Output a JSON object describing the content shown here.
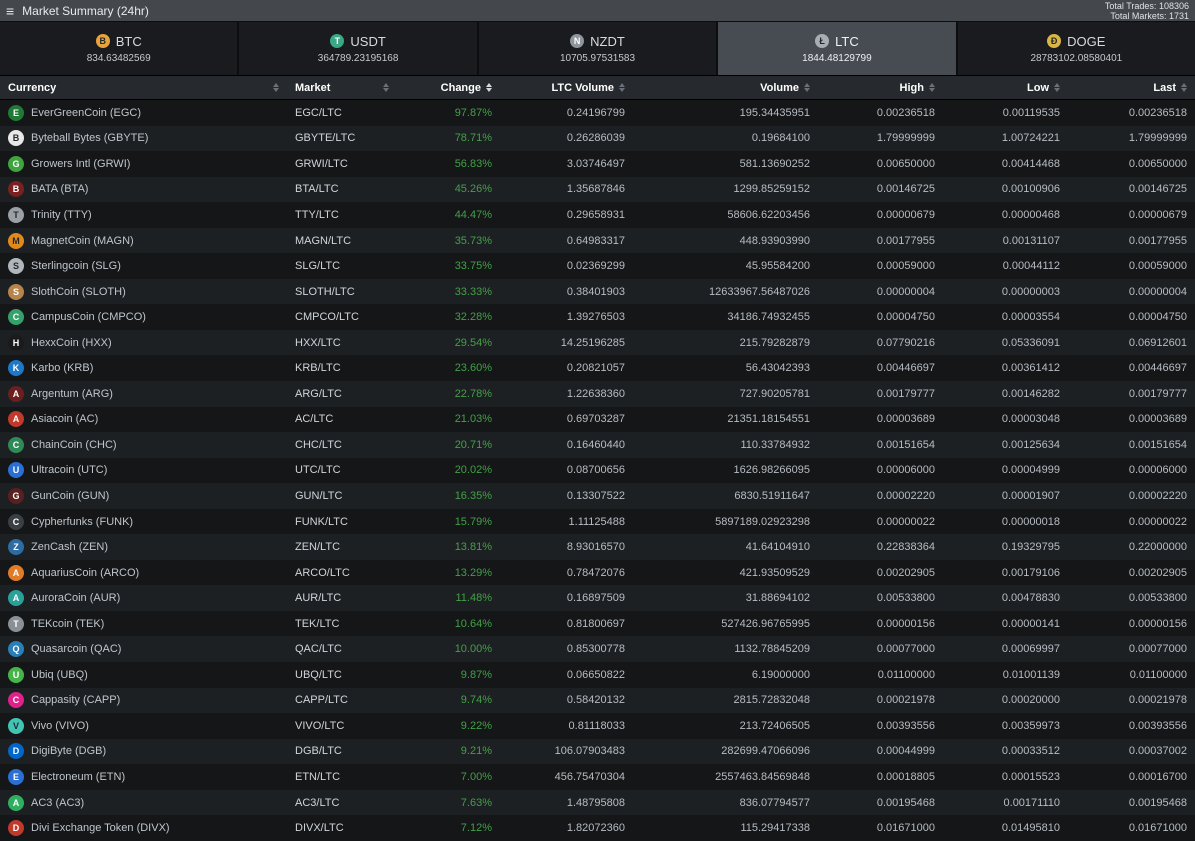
{
  "topbar": {
    "menu_icon": "≡",
    "title": "Market Summary (24hr)",
    "total_trades_label": "Total Trades:",
    "total_trades": "108306",
    "total_markets_label": "Total Markets:",
    "total_markets": "1731"
  },
  "tabs": [
    {
      "label": "BTC",
      "value": "834.63482569",
      "icon_letter": "B",
      "icon_color": "#e8a33d",
      "active": false
    },
    {
      "label": "USDT",
      "value": "364789.23195168",
      "icon_letter": "T",
      "icon_color": "#3aa884",
      "active": false
    },
    {
      "label": "NZDT",
      "value": "10705.97531583",
      "icon_letter": "N",
      "icon_color": "#8e959c",
      "active": false
    },
    {
      "label": "LTC",
      "value": "1844.48129799",
      "icon_letter": "Ł",
      "icon_color": "#a8adb3",
      "active": true
    },
    {
      "label": "DOGE",
      "value": "28783102.08580401",
      "icon_letter": "Ð",
      "icon_color": "#d8b545",
      "active": false
    }
  ],
  "table": {
    "columns": [
      {
        "label": "Currency",
        "align": "left"
      },
      {
        "label": "Market",
        "align": "left"
      },
      {
        "label": "Change",
        "align": "right"
      },
      {
        "label": "LTC Volume",
        "align": "right"
      },
      {
        "label": "Volume",
        "align": "right"
      },
      {
        "label": "High",
        "align": "right"
      },
      {
        "label": "Low",
        "align": "right"
      },
      {
        "label": "Last",
        "align": "right"
      }
    ],
    "sorted_column": "Change",
    "rows": [
      {
        "currency": "EverGreenCoin (EGC)",
        "icon_color": "#1e7a34",
        "market": "EGC/LTC",
        "change": "97.87%",
        "ltc_volume": "0.24196799",
        "volume": "195.34435951",
        "high": "0.00236518",
        "low": "0.00119535",
        "last": "0.00236518"
      },
      {
        "currency": "Byteball Bytes (GBYTE)",
        "icon_color": "#e8e8e8",
        "market": "GBYTE/LTC",
        "change": "78.71%",
        "ltc_volume": "0.26286039",
        "volume": "0.19684100",
        "high": "1.79999999",
        "low": "1.00724221",
        "last": "1.79999999"
      },
      {
        "currency": "Growers Intl (GRWI)",
        "icon_color": "#3fa33f",
        "market": "GRWI/LTC",
        "change": "56.83%",
        "ltc_volume": "3.03746497",
        "volume": "581.13690252",
        "high": "0.00650000",
        "low": "0.00414468",
        "last": "0.00650000"
      },
      {
        "currency": "BATA (BTA)",
        "icon_color": "#7a2020",
        "market": "BTA/LTC",
        "change": "45.26%",
        "ltc_volume": "1.35687846",
        "volume": "1299.85259152",
        "high": "0.00146725",
        "low": "0.00100906",
        "last": "0.00146725"
      },
      {
        "currency": "Trinity (TTY)",
        "icon_color": "#9aa0a6",
        "market": "TTY/LTC",
        "change": "44.47%",
        "ltc_volume": "0.29658931",
        "volume": "58606.62203456",
        "high": "0.00000679",
        "low": "0.00000468",
        "last": "0.00000679"
      },
      {
        "currency": "MagnetCoin (MAGN)",
        "icon_color": "#e08a1e",
        "market": "MAGN/LTC",
        "change": "35.73%",
        "ltc_volume": "0.64983317",
        "volume": "448.93903990",
        "high": "0.00177955",
        "low": "0.00131107",
        "last": "0.00177955"
      },
      {
        "currency": "Sterlingcoin (SLG)",
        "icon_color": "#b0b6bc",
        "market": "SLG/LTC",
        "change": "33.75%",
        "ltc_volume": "0.02369299",
        "volume": "45.95584200",
        "high": "0.00059000",
        "low": "0.00044112",
        "last": "0.00059000"
      },
      {
        "currency": "SlothCoin (SLOTH)",
        "icon_color": "#b5854b",
        "market": "SLOTH/LTC",
        "change": "33.33%",
        "ltc_volume": "0.38401903",
        "volume": "12633967.56487026",
        "high": "0.00000004",
        "low": "0.00000003",
        "last": "0.00000004"
      },
      {
        "currency": "CampusCoin (CMPCO)",
        "icon_color": "#35a06a",
        "market": "CMPCO/LTC",
        "change": "32.28%",
        "ltc_volume": "1.39276503",
        "volume": "34186.74932455",
        "high": "0.00004750",
        "low": "0.00003554",
        "last": "0.00004750"
      },
      {
        "currency": "HexxCoin (HXX)",
        "icon_color": "#1a1a1a",
        "market": "HXX/LTC",
        "change": "29.54%",
        "ltc_volume": "14.25196285",
        "volume": "215.79282879",
        "high": "0.07790216",
        "low": "0.05336091",
        "last": "0.06912601"
      },
      {
        "currency": "Karbo (KRB)",
        "icon_color": "#1e78c8",
        "market": "KRB/LTC",
        "change": "23.60%",
        "ltc_volume": "0.20821057",
        "volume": "56.43042393",
        "high": "0.00446697",
        "low": "0.00361412",
        "last": "0.00446697"
      },
      {
        "currency": "Argentum (ARG)",
        "icon_color": "#6b1f1f",
        "market": "ARG/LTC",
        "change": "22.78%",
        "ltc_volume": "1.22638360",
        "volume": "727.90205781",
        "high": "0.00179777",
        "low": "0.00146282",
        "last": "0.00179777"
      },
      {
        "currency": "Asiacoin (AC)",
        "icon_color": "#c0392b",
        "market": "AC/LTC",
        "change": "21.03%",
        "ltc_volume": "0.69703287",
        "volume": "21351.18154551",
        "high": "0.00003689",
        "low": "0.00003048",
        "last": "0.00003689"
      },
      {
        "currency": "ChainCoin (CHC)",
        "icon_color": "#2e8b57",
        "market": "CHC/LTC",
        "change": "20.71%",
        "ltc_volume": "0.16460440",
        "volume": "110.33784932",
        "high": "0.00151654",
        "low": "0.00125634",
        "last": "0.00151654"
      },
      {
        "currency": "Ultracoin (UTC)",
        "icon_color": "#2a6fd4",
        "market": "UTC/LTC",
        "change": "20.02%",
        "ltc_volume": "0.08700656",
        "volume": "1626.98266095",
        "high": "0.00006000",
        "low": "0.00004999",
        "last": "0.00006000"
      },
      {
        "currency": "GunCoin (GUN)",
        "icon_color": "#5a1f1f",
        "market": "GUN/LTC",
        "change": "16.35%",
        "ltc_volume": "0.13307522",
        "volume": "6830.51911647",
        "high": "0.00002220",
        "low": "0.00001907",
        "last": "0.00002220"
      },
      {
        "currency": "Cypherfunks (FUNK)",
        "icon_color": "#3a3f44",
        "market": "FUNK/LTC",
        "change": "15.79%",
        "ltc_volume": "1.11125488",
        "volume": "5897189.02923298",
        "high": "0.00000022",
        "low": "0.00000018",
        "last": "0.00000022"
      },
      {
        "currency": "ZenCash (ZEN)",
        "icon_color": "#2d6ca2",
        "market": "ZEN/LTC",
        "change": "13.81%",
        "ltc_volume": "8.93016570",
        "volume": "41.64104910",
        "high": "0.22838364",
        "low": "0.19329795",
        "last": "0.22000000"
      },
      {
        "currency": "AquariusCoin (ARCO)",
        "icon_color": "#e07b2a",
        "market": "ARCO/LTC",
        "change": "13.29%",
        "ltc_volume": "0.78472076",
        "volume": "421.93509529",
        "high": "0.00202905",
        "low": "0.00179106",
        "last": "0.00202905"
      },
      {
        "currency": "AuroraCoin (AUR)",
        "icon_color": "#2aa198",
        "market": "AUR/LTC",
        "change": "11.48%",
        "ltc_volume": "0.16897509",
        "volume": "31.88694102",
        "high": "0.00533800",
        "low": "0.00478830",
        "last": "0.00533800"
      },
      {
        "currency": "TEKcoin (TEK)",
        "icon_color": "#8a9096",
        "market": "TEK/LTC",
        "change": "10.64%",
        "ltc_volume": "0.81800697",
        "volume": "527426.96765995",
        "high": "0.00000156",
        "low": "0.00000141",
        "last": "0.00000156"
      },
      {
        "currency": "Quasarcoin (QAC)",
        "icon_color": "#2980b9",
        "market": "QAC/LTC",
        "change": "10.00%",
        "ltc_volume": "0.85300778",
        "volume": "1132.78845209",
        "high": "0.00077000",
        "low": "0.00069997",
        "last": "0.00077000"
      },
      {
        "currency": "Ubiq (UBQ)",
        "icon_color": "#45b549",
        "market": "UBQ/LTC",
        "change": "9.87%",
        "ltc_volume": "0.06650822",
        "volume": "6.19000000",
        "high": "0.01100000",
        "low": "0.01001139",
        "last": "0.01100000"
      },
      {
        "currency": "Cappasity (CAPP)",
        "icon_color": "#e0218a",
        "market": "CAPP/LTC",
        "change": "9.74%",
        "ltc_volume": "0.58420132",
        "volume": "2815.72832048",
        "high": "0.00021978",
        "low": "0.00020000",
        "last": "0.00021978"
      },
      {
        "currency": "Vivo (VIVO)",
        "icon_color": "#40c4b4",
        "market": "VIVO/LTC",
        "change": "9.22%",
        "ltc_volume": "0.81118033",
        "volume": "213.72406505",
        "high": "0.00393556",
        "low": "0.00359973",
        "last": "0.00393556"
      },
      {
        "currency": "DigiByte (DGB)",
        "icon_color": "#0066cc",
        "market": "DGB/LTC",
        "change": "9.21%",
        "ltc_volume": "106.07903483",
        "volume": "282699.47066096",
        "high": "0.00044999",
        "low": "0.00033512",
        "last": "0.00037002"
      },
      {
        "currency": "Electroneum (ETN)",
        "icon_color": "#2b6fd4",
        "market": "ETN/LTC",
        "change": "7.00%",
        "ltc_volume": "456.75470304",
        "volume": "2557463.84569848",
        "high": "0.00018805",
        "low": "0.00015523",
        "last": "0.00016700"
      },
      {
        "currency": "AC3 (AC3)",
        "icon_color": "#2eaf5f",
        "market": "AC3/LTC",
        "change": "7.63%",
        "ltc_volume": "1.48795808",
        "volume": "836.07794577",
        "high": "0.00195468",
        "low": "0.00171110",
        "last": "0.00195468"
      },
      {
        "currency": "Divi Exchange Token (DIVX)",
        "icon_color": "#c0392b",
        "market": "DIVX/LTC",
        "change": "7.12%",
        "ltc_volume": "1.82072360",
        "volume": "115.29417338",
        "high": "0.01671000",
        "low": "0.01495810",
        "last": "0.01671000"
      }
    ]
  },
  "colors": {
    "positive": "#43a047"
  }
}
